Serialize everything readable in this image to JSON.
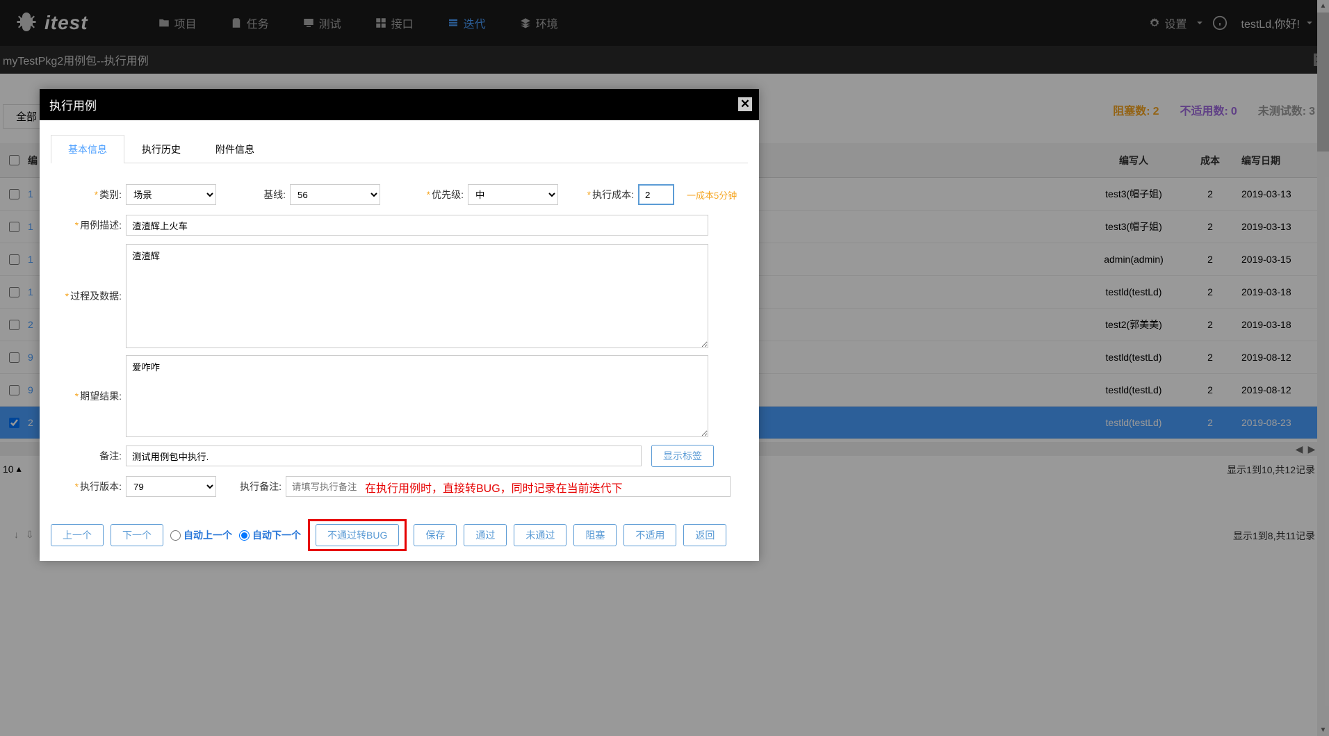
{
  "nav": {
    "logo_text": "itest",
    "items": [
      "项目",
      "任务",
      "测试",
      "接口",
      "迭代",
      "环境"
    ],
    "settings": "设置",
    "greeting": "testLd,你好!"
  },
  "breadcrumb": "myTestPkg2用例包--执行用例",
  "tab_all": "全部",
  "stats": {
    "blocked_label": "阻塞数:",
    "blocked_value": "2",
    "na_label": "不适用数:",
    "na_value": "0",
    "untested_label": "未测试数:",
    "untested_value": "3"
  },
  "bg_table": {
    "headers": {
      "id": "编",
      "author": "编写人",
      "cost": "成本",
      "date": "编写日期"
    },
    "rows": [
      {
        "id": "1",
        "author": "test3(帽子姐)",
        "cost": "2",
        "date": "2019-03-13"
      },
      {
        "id": "1",
        "author": "test3(帽子姐)",
        "cost": "2",
        "date": "2019-03-13"
      },
      {
        "id": "1",
        "author": "admin(admin)",
        "cost": "2",
        "date": "2019-03-15"
      },
      {
        "id": "1",
        "author": "testld(testLd)",
        "cost": "2",
        "date": "2019-03-18"
      },
      {
        "id": "2",
        "author": "test2(郭美美)",
        "cost": "2",
        "date": "2019-03-18"
      },
      {
        "id": "9",
        "author": "testld(testLd)",
        "cost": "2",
        "date": "2019-08-12"
      },
      {
        "id": "9",
        "author": "testld(testLd)",
        "cost": "2",
        "date": "2019-08-12"
      },
      {
        "id": "2",
        "author": "testld(testLd)",
        "cost": "2",
        "date": "2019-08-23",
        "selected": true
      }
    ],
    "pager": "10",
    "footer1": "显示1到10,共12记录",
    "footer2": "显示1到8,共11记录"
  },
  "modal": {
    "title": "执行用例",
    "tabs": [
      "基本信息",
      "执行历史",
      "附件信息"
    ],
    "labels": {
      "category": "类别:",
      "baseline": "基线:",
      "priority": "优先级:",
      "exec_cost": "执行成本:",
      "desc": "用例描述:",
      "process": "过程及数据:",
      "expected": "期望结果:",
      "remark": "备注:",
      "exec_version": "执行版本:",
      "exec_remark": "执行备注:"
    },
    "values": {
      "category": "场景",
      "baseline": "56",
      "priority": "中",
      "exec_cost": "2",
      "desc": "渣渣辉上火车",
      "process": "渣渣辉",
      "expected": "爱咋咋",
      "remark": "测试用例包中执行.",
      "exec_version": "79",
      "exec_remark_placeholder": "请填写执行备注"
    },
    "cost_hint": "一成本5分钟",
    "show_tags": "显示标签",
    "annotation": "在执行用例时，直接转BUG，同时记录在当前迭代下",
    "buttons": {
      "prev": "上一个",
      "next": "下一个",
      "auto_prev": "自动上一个",
      "auto_next": "自动下一个",
      "fail_to_bug": "不通过转BUG",
      "save": "保存",
      "pass": "通过",
      "fail": "未通过",
      "block": "阻塞",
      "na": "不适用",
      "back": "返回"
    }
  }
}
